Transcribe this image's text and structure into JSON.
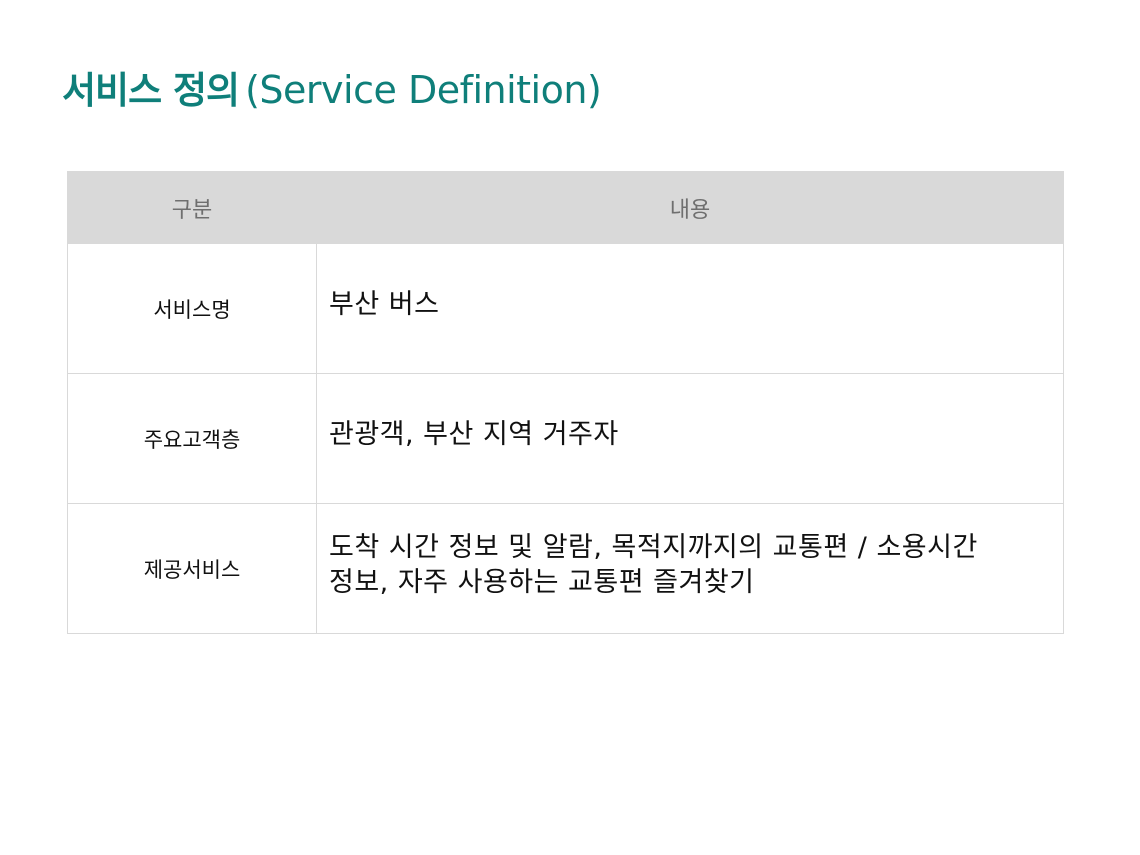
{
  "slide": {
    "title_korean": "서비스 정의",
    "title_english": "(Service Definition)"
  },
  "table": {
    "headers": [
      "구분",
      "내용"
    ],
    "rows": [
      {
        "category": "서비스명",
        "content": "부산 버스"
      },
      {
        "category": "주요고객층",
        "content": "관광객, 부산 지역 거주자"
      },
      {
        "category": "제공서비스",
        "content": "도착 시간 정보 및 알람, 목적지까지의 교통편 / 소용시간 정보, 자주 사용하는 교통편 즐겨찾기"
      }
    ]
  },
  "colors": {
    "title": "#0f7f7a",
    "header_background": "#d9d9d9",
    "header_text": "#6f6f6f",
    "border": "#d9d9d9"
  }
}
